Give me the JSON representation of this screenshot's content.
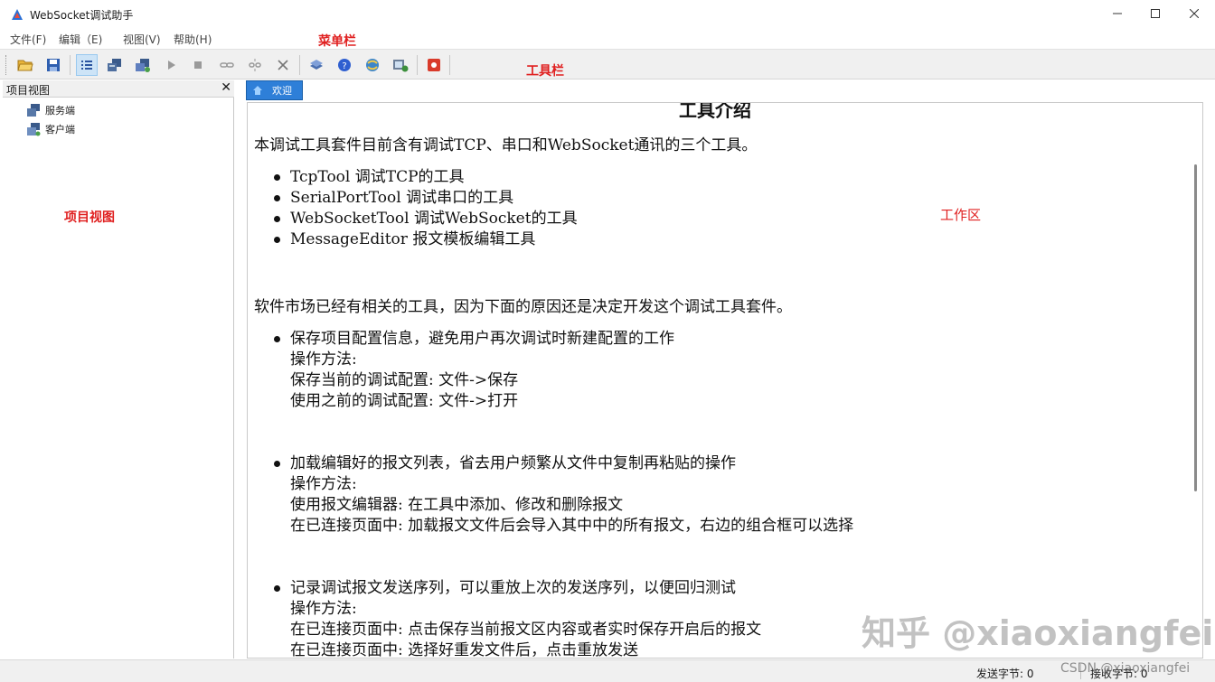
{
  "window": {
    "title": "WebSocket调试助手"
  },
  "menu": {
    "items": [
      "文件(F)",
      "编辑（E)",
      "视图(V)",
      "帮助(H)"
    ]
  },
  "annotations": {
    "menubar": "菜单栏",
    "toolbar": "工具栏",
    "project_view": "项目视图",
    "workarea": "工作区"
  },
  "toolbar": {
    "icons": [
      "open-folder-icon",
      "save-icon",
      "list-view-icon",
      "server-icon",
      "client-icon",
      "play-icon",
      "stop-icon",
      "connect-icon",
      "disconnect-icon",
      "close-icon",
      "book-icon",
      "help-icon",
      "network-icon",
      "image-settings-icon",
      "record-icon"
    ]
  },
  "project_panel": {
    "title": "项目视图",
    "items": [
      "服务端",
      "客户端"
    ]
  },
  "tab": {
    "label": "欢迎"
  },
  "doc": {
    "title": "工具介绍",
    "intro": "本调试工具套件目前含有调试TCP、串口和WebSocket通讯的三个工具。",
    "tools": [
      "TcpTool 调试TCP的工具",
      "SerialPortTool 调试串口的工具",
      "WebSocketTool 调试WebSocket的工具",
      "MessageEditor 报文模板编辑工具"
    ],
    "reason": "软件市场已经有相关的工具，因为下面的原因还是决定开发这个调试工具套件。",
    "features": [
      {
        "head": "保存项目配置信息，避免用户再次调试时新建配置的工作",
        "lines": [
          "操作方法:",
          "保存当前的调试配置: 文件->保存",
          "使用之前的调试配置: 文件->打开"
        ]
      },
      {
        "head": "加载编辑好的报文列表，省去用户频繁从文件中复制再粘贴的操作",
        "lines": [
          "操作方法:",
          "使用报文编辑器: 在工具中添加、修改和删除报文",
          "在已连接页面中: 加载报文文件后会导入其中中的所有报文，右边的组合框可以选择"
        ]
      },
      {
        "head": "记录调试报文发送序列，可以重放上次的发送序列，以便回归测试",
        "lines": [
          "操作方法:",
          "在已连接页面中: 点击保存当前报文区内容或者实时保存开启后的报文",
          "在已连接页面中: 选择好重发文件后，点击重放发送"
        ]
      }
    ]
  },
  "watermark": "知乎 @xiaoxiangfei",
  "status": {
    "sent": "发送字节: 0",
    "received": "接收字节: 0",
    "csdn": "CSDN @xiaoxiangfei"
  }
}
